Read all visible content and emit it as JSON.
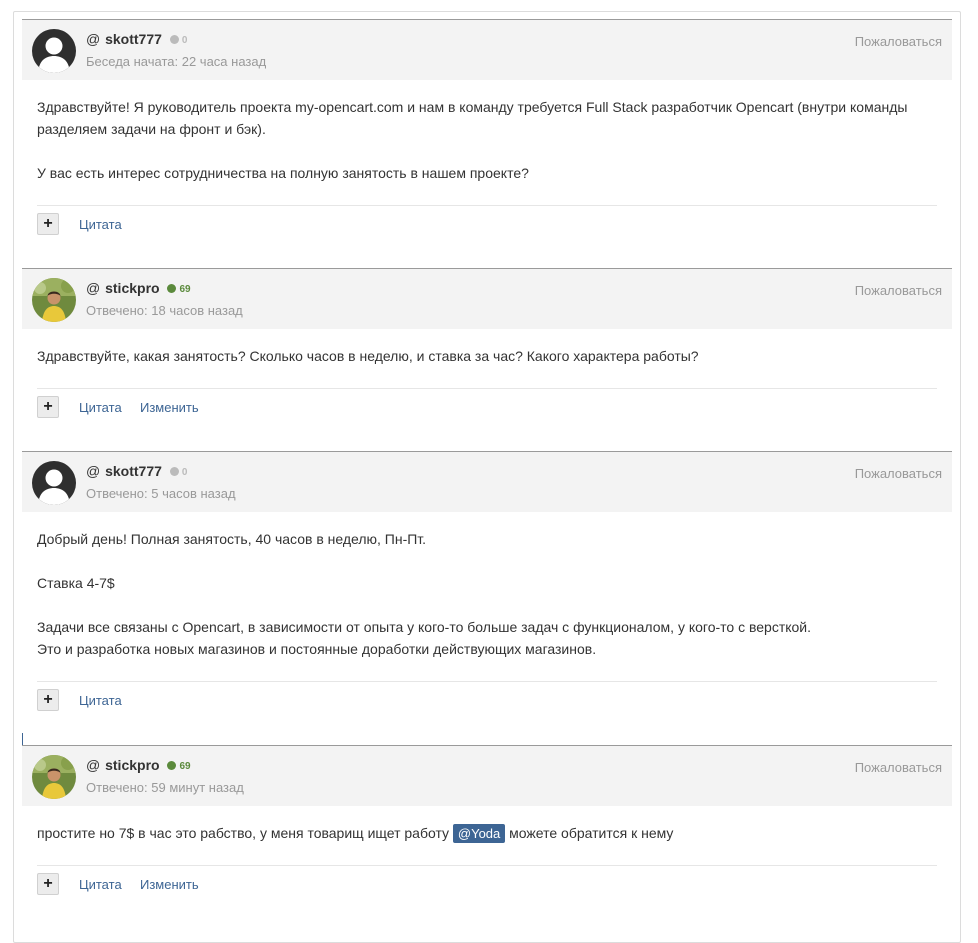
{
  "posts": [
    {
      "author": "skott777",
      "rep": "0",
      "rep_color": "#bbbbbb",
      "avatar": "default",
      "meta": "Беседа начата: 22 часа назад",
      "report": "Пожаловаться",
      "body": [
        "Здравствуйте! Я руководитель проекта my-opencart.com и нам в команду требуется Full Stack разработчик Opencart (внутри команды",
        "разделяем задачи на фронт и бэк).",
        "",
        "У вас есть интерес сотрудничества на полную занятость в нашем проекте?"
      ],
      "quote": "Цитата"
    },
    {
      "author": "stickpro",
      "rep": "69",
      "rep_color": "#5b8a3c",
      "avatar": "photo",
      "meta": "Отвечено: 18 часов назад",
      "report": "Пожаловаться",
      "body": [
        "Здравствуйте, какая занятость? Сколько часов в неделю, и ставка за час? Какого характера работы?"
      ],
      "quote": "Цитата",
      "edit": "Изменить"
    },
    {
      "author": "skott777",
      "rep": "0",
      "rep_color": "#bbbbbb",
      "avatar": "default",
      "meta": "Отвечено: 5 часов назад",
      "report": "Пожаловаться",
      "body": [
        "Добрый день! Полная занятость, 40 часов в неделю, Пн-Пт.",
        "",
        "Ставка 4-7$",
        "",
        "Задачи все связаны с Opencart, в зависимости от опыта у кого-то больше задач с функционалом, у кого-то с версткой.",
        "Это и разработка новых магазинов и постоянные доработки действующих магазинов."
      ],
      "quote": "Цитата"
    },
    {
      "author": "stickpro",
      "rep": "69",
      "rep_color": "#5b8a3c",
      "avatar": "photo",
      "meta": "Отвечено: 59 минут назад",
      "report": "Пожаловаться",
      "body_before": "простите но 7$ в час это рабство, у меня товарищ ищет работу",
      "mention": "@Yoda",
      "body_after": "можете обратится к нему",
      "quote": "Цитата",
      "edit": "Изменить"
    }
  ],
  "at_symbol": "@",
  "plus_symbol": "+",
  "colors": {
    "link": "#3d6594",
    "header_bg": "#f3f3f3",
    "muted": "#999999"
  }
}
